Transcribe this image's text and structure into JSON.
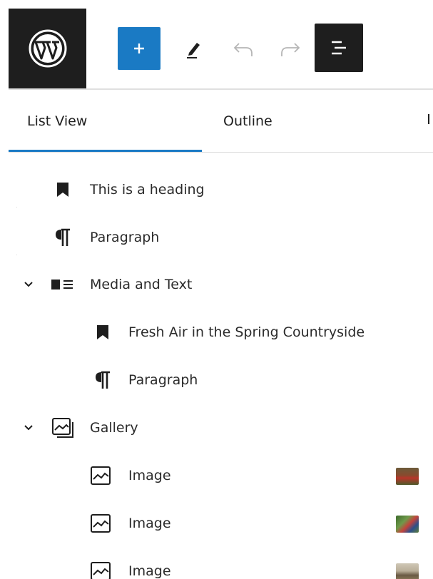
{
  "toolbar": {
    "logo_icon": "wordpress-logo-icon",
    "add_block_icon": "plus-icon",
    "tools_icon": "pencil-icon",
    "undo_icon": "undo-icon",
    "redo_icon": "redo-icon",
    "document_overview_icon": "list-view-icon"
  },
  "tabs": [
    {
      "label": "List View",
      "active": true
    },
    {
      "label": "Outline",
      "active": false
    }
  ],
  "list": [
    {
      "label": "This is a heading",
      "icon": "bookmark-icon",
      "level": 1
    },
    {
      "label": "Paragraph",
      "icon": "paragraph-icon",
      "level": 1
    },
    {
      "label": "Media and Text",
      "icon": "media-text-icon",
      "level": 1,
      "expanded": true
    },
    {
      "label": "Fresh Air in the Spring Countryside",
      "icon": "bookmark-icon",
      "level": 2
    },
    {
      "label": "Paragraph",
      "icon": "paragraph-icon",
      "level": 2
    },
    {
      "label": "Gallery",
      "icon": "gallery-icon",
      "level": 1,
      "expanded": true
    },
    {
      "label": "Image",
      "icon": "image-icon",
      "level": 2,
      "thumbnail": true
    },
    {
      "label": "Image",
      "icon": "image-icon",
      "level": 2,
      "thumbnail": true
    },
    {
      "label": "Image",
      "icon": "image-icon",
      "level": 2,
      "thumbnail": true
    }
  ],
  "colors": {
    "accent": "#1a7ac4",
    "dark": "#1e1e1e",
    "border": "#e0e0e0"
  }
}
